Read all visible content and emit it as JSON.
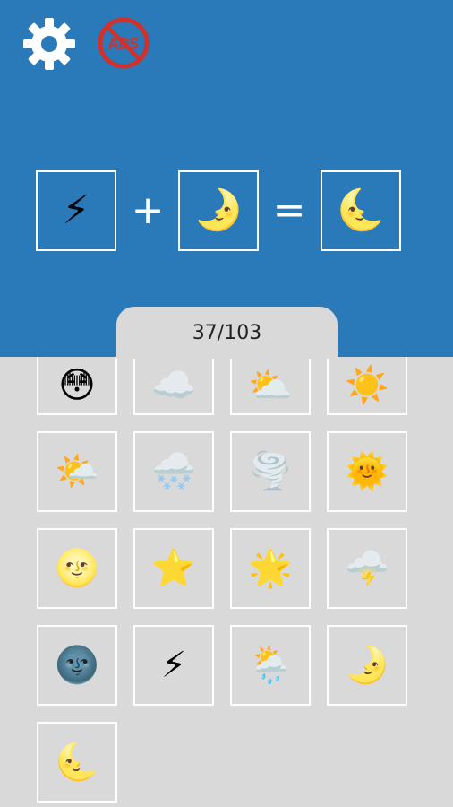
{
  "header": {
    "settings_icon": "gear-icon",
    "no_ads_icon": "no-ads-icon",
    "no_ads_label": "ADS",
    "colors": {
      "background": "#2a7ab9",
      "lower": "#d9d9d9",
      "no_ads": "#d0312d"
    }
  },
  "equation": {
    "left": "⚡",
    "plus": "+",
    "right": "🌛",
    "equals": "=",
    "result": "🌜"
  },
  "progress": {
    "label": "37/103"
  },
  "items": [
    "😳",
    "☁️",
    "⛅",
    "☀️",
    "🌤️",
    "🌨️",
    "🌪️",
    "🌞",
    "🌝",
    "⭐",
    "🌟",
    "🌩️",
    "🌚",
    "⚡",
    "🌦️",
    "🌛",
    "🌜"
  ]
}
